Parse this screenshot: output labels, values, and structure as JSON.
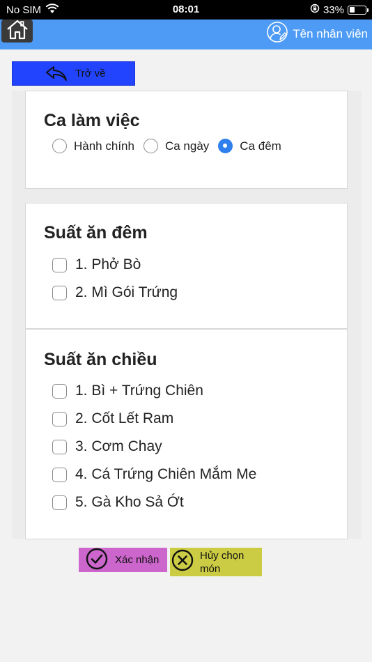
{
  "status_bar": {
    "carrier": "No SIM",
    "time": "08:01",
    "battery_percent": "33%",
    "battery_level": 0.33
  },
  "header": {
    "user_label": "Tên nhân viên"
  },
  "back_button": {
    "label": "Trở về"
  },
  "shift_card": {
    "title": "Ca làm việc",
    "options": [
      {
        "label": "Hành chính",
        "selected": false
      },
      {
        "label": "Ca ngày",
        "selected": false
      },
      {
        "label": "Ca đêm",
        "selected": true
      }
    ]
  },
  "night_meal_card": {
    "title": "Suất ăn đêm",
    "items": [
      {
        "label": "1. Phở Bò",
        "checked": false
      },
      {
        "label": "2. Mì Gói Trứng",
        "checked": false
      }
    ]
  },
  "afternoon_meal_card": {
    "title": "Suất ăn chiều",
    "items": [
      {
        "label": "1. Bì + Trứng Chiên",
        "checked": false
      },
      {
        "label": "2. Cốt Lết Ram",
        "checked": false
      },
      {
        "label": "3. Cơm Chay",
        "checked": false
      },
      {
        "label": "4. Cá Trứng Chiên Mắm Me",
        "checked": false
      },
      {
        "label": "5. Gà Kho Sả Ớt",
        "checked": false
      }
    ]
  },
  "actions": {
    "confirm_label": "Xác nhận",
    "cancel_line1": "Hủy chọn",
    "cancel_line2": "món"
  },
  "colors": {
    "header": "#4d9bf5",
    "back_button": "#2244ff",
    "confirm": "#cc66cc",
    "cancel": "#cccc44",
    "radio_selected": "#2f80ed"
  }
}
